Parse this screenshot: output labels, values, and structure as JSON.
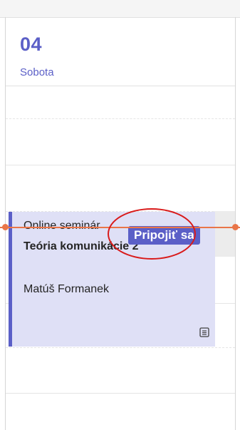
{
  "day_header": {
    "day_number": "04",
    "day_name": "Sobota"
  },
  "event": {
    "title": "Online seminár",
    "subtitle": "Teória komunikácie 2",
    "organizer": "Matúš Formanek",
    "join_label": "Pripojiť sa",
    "accent_color": "#5b5fc7",
    "background_color": "#dfe0f6"
  },
  "current_time_indicator": {
    "color": "#e97548"
  },
  "annotation": {
    "color": "#d91a1a",
    "icon": "highlight-ellipse"
  },
  "icons": {
    "details": "note-icon"
  }
}
